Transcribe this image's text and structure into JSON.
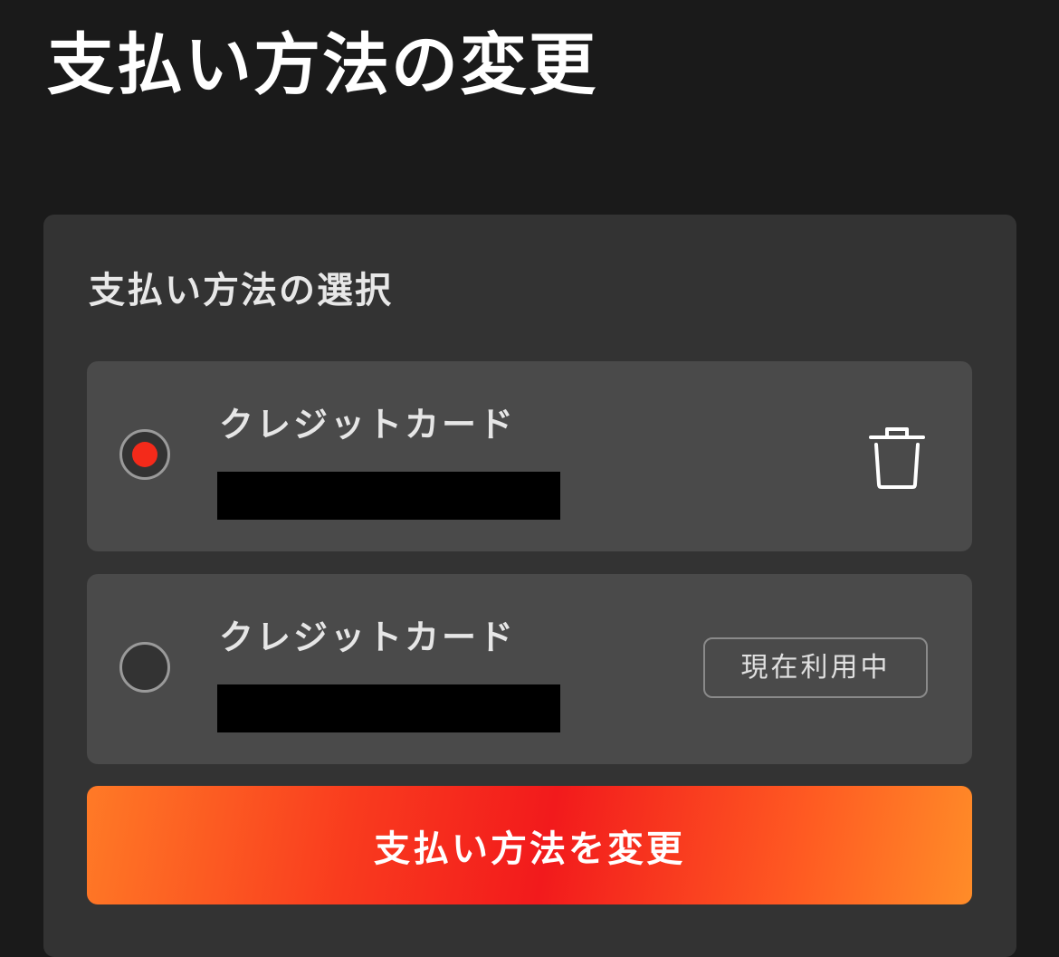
{
  "page": {
    "title": "支払い方法の変更"
  },
  "section": {
    "title": "支払い方法の選択"
  },
  "payment_methods": [
    {
      "label": "クレジットカード",
      "selected": true,
      "action_icon": "trash-icon"
    },
    {
      "label": "クレジットカード",
      "selected": false,
      "badge": "現在利用中"
    }
  ],
  "actions": {
    "change_label": "支払い方法を変更"
  },
  "colors": {
    "background": "#1a1a1a",
    "panel": "#333333",
    "card": "#4a4a4a",
    "radio_selected": "#f42a1a",
    "button_gradient_start": "#ff7a26",
    "button_gradient_mid": "#f21a1c",
    "button_gradient_end": "#ff8c28"
  }
}
